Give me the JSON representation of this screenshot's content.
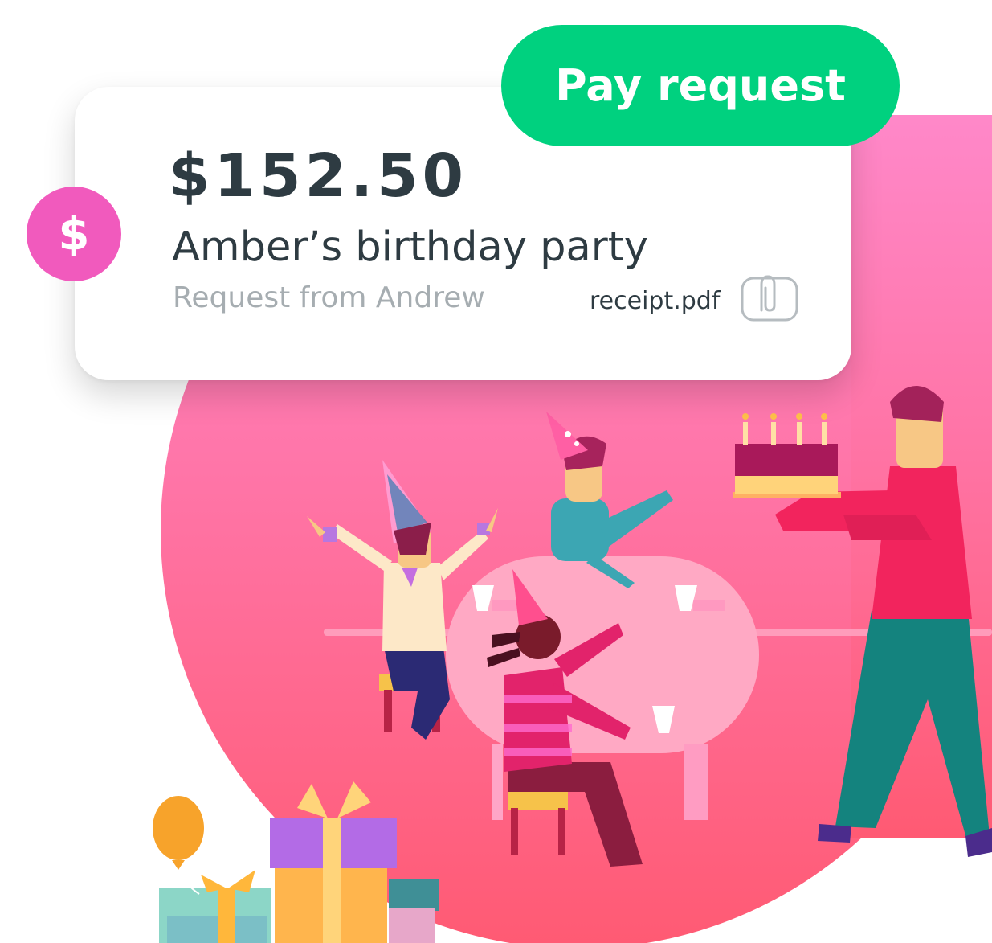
{
  "request": {
    "amount": "$152.50",
    "title": "Amber’s birthday party",
    "requester_text": "Request from Andrew",
    "attachment_name": "receipt.pdf"
  },
  "badge": {
    "symbol": "$",
    "icon": "dollar-icon"
  },
  "actions": {
    "pay_label": "Pay request"
  },
  "colors": {
    "accent_green": "#00d17f",
    "badge_pink": "#f15abd",
    "text_dark": "#2e3b42",
    "text_muted": "#a6adb1",
    "background_circle_top": "#ff86c8",
    "background_circle_bottom": "#ff5c74"
  },
  "illustration": {
    "subject": "birthday-party-scene"
  }
}
